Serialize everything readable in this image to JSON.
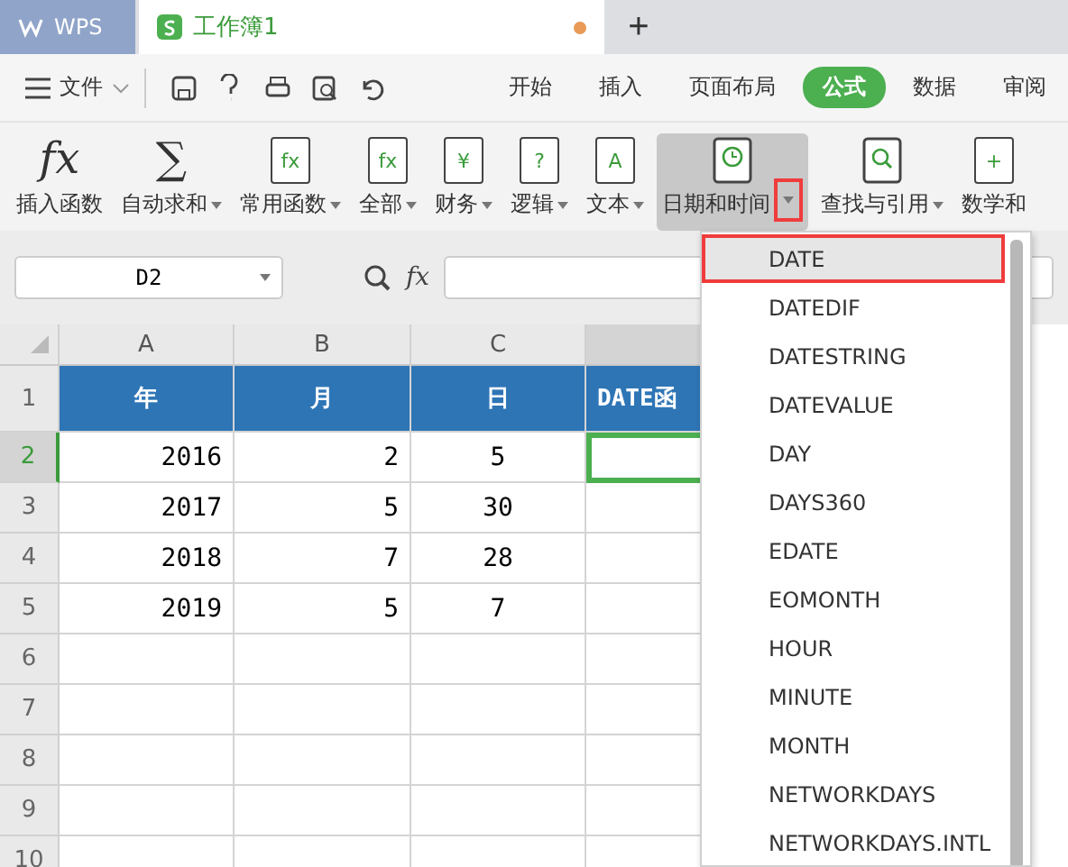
{
  "app_tab": {
    "label": "WPS"
  },
  "doc_tab": {
    "title": "工作簿1",
    "unsaved": true
  },
  "new_tab": {
    "label": "+"
  },
  "menu": {
    "file": "文件",
    "tabs": [
      {
        "label": "开始",
        "selected": false
      },
      {
        "label": "插入",
        "selected": false
      },
      {
        "label": "页面布局",
        "selected": false
      },
      {
        "label": "公式",
        "selected": true
      },
      {
        "label": "数据",
        "selected": false
      },
      {
        "label": "审阅",
        "selected": false
      }
    ]
  },
  "ribbon": [
    {
      "label": "插入函数",
      "kind": "glyph",
      "glyph": "fx",
      "dropdown": false,
      "selected": false
    },
    {
      "label": "自动求和",
      "kind": "glyph",
      "glyph": "∑",
      "dropdown": true,
      "selected": false
    },
    {
      "label": "常用函数",
      "kind": "book",
      "glyph": "fx",
      "dropdown": true,
      "selected": false
    },
    {
      "label": "全部",
      "kind": "book",
      "glyph": "fx",
      "dropdown": true,
      "selected": false
    },
    {
      "label": "财务",
      "kind": "book",
      "glyph": "¥",
      "dropdown": true,
      "selected": false
    },
    {
      "label": "逻辑",
      "kind": "book",
      "glyph": "?",
      "dropdown": true,
      "selected": false
    },
    {
      "label": "文本",
      "kind": "book",
      "glyph": "A",
      "dropdown": true,
      "selected": false
    },
    {
      "label": "日期和时间",
      "kind": "clock",
      "dropdown": true,
      "selected": true
    },
    {
      "label": "查找与引用",
      "kind": "search",
      "dropdown": true,
      "selected": false
    },
    {
      "label": "数学和",
      "kind": "book",
      "glyph": "+",
      "dropdown": false,
      "selected": false
    }
  ],
  "formula_bar": {
    "cell_ref": "D2",
    "fx": "fx"
  },
  "sheet": {
    "columns": [
      {
        "label": "A",
        "selected": false
      },
      {
        "label": "B",
        "selected": false
      },
      {
        "label": "C",
        "selected": false
      },
      {
        "selected": true
      }
    ],
    "rows": [
      {
        "label": "1",
        "selected": false,
        "header": true,
        "cells": [
          "年",
          "月",
          "日",
          "DATE函"
        ]
      },
      {
        "label": "2",
        "selected": true,
        "header": false,
        "cells": [
          "2016",
          "2",
          "5",
          ""
        ]
      },
      {
        "label": "3",
        "selected": false,
        "header": false,
        "cells": [
          "2017",
          "5",
          "30",
          ""
        ]
      },
      {
        "label": "4",
        "selected": false,
        "header": false,
        "cells": [
          "2018",
          "7",
          "28",
          ""
        ]
      },
      {
        "label": "5",
        "selected": false,
        "header": false,
        "cells": [
          "2019",
          "5",
          "7",
          ""
        ]
      },
      {
        "label": "6",
        "selected": false,
        "header": false,
        "cells": [
          "",
          "",
          "",
          ""
        ]
      },
      {
        "label": "7",
        "selected": false,
        "header": false,
        "cells": [
          "",
          "",
          "",
          ""
        ]
      },
      {
        "label": "8",
        "selected": false,
        "header": false,
        "cells": [
          "",
          "",
          "",
          ""
        ]
      },
      {
        "label": "9",
        "selected": false,
        "header": false,
        "cells": [
          "",
          "",
          "",
          ""
        ]
      },
      {
        "label": "10",
        "selected": false,
        "header": false,
        "cells": [
          "",
          "",
          "",
          ""
        ]
      }
    ]
  },
  "dropdown": [
    {
      "label": "DATE",
      "selected": true
    },
    {
      "label": "DATEDIF",
      "selected": false
    },
    {
      "label": "DATESTRING",
      "selected": false
    },
    {
      "label": "DATEVALUE",
      "selected": false
    },
    {
      "label": "DAY",
      "selected": false
    },
    {
      "label": "DAYS360",
      "selected": false
    },
    {
      "label": "EDATE",
      "selected": false
    },
    {
      "label": "EOMONTH",
      "selected": false
    },
    {
      "label": "HOUR",
      "selected": false
    },
    {
      "label": "MINUTE",
      "selected": false
    },
    {
      "label": "MONTH",
      "selected": false
    },
    {
      "label": "NETWORKDAYS",
      "selected": false
    },
    {
      "label": "NETWORKDAYS.INTL",
      "selected": false
    }
  ]
}
